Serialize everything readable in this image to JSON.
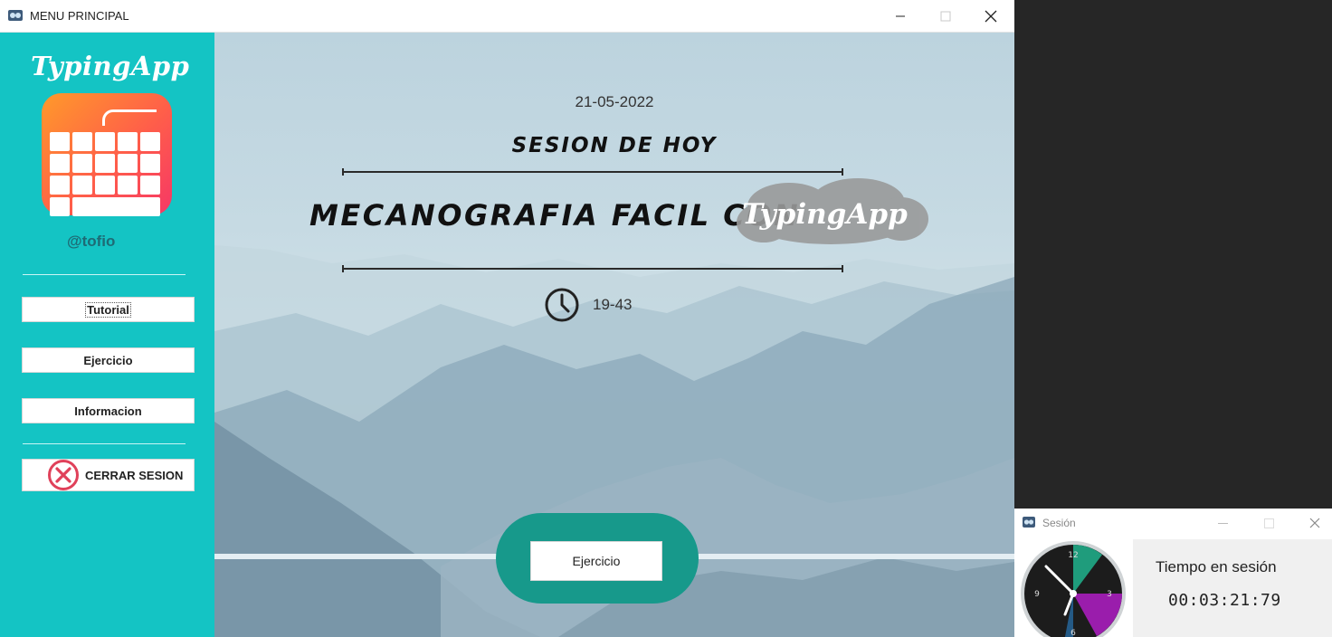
{
  "main_window": {
    "title": "MENU PRINCIPAL",
    "controls": {
      "minimize": "minimize-icon",
      "maximize": "maximize-icon",
      "close": "close-icon"
    }
  },
  "sidebar": {
    "brand": "TypingApp",
    "logo_icon": "keyboard-icon",
    "username": "@tofio",
    "buttons": {
      "tutorial": "Tutorial",
      "ejercicio": "Ejercicio",
      "informacion": "Informacion",
      "logout": "CERRAR SESION"
    },
    "logout_icon": "x-circle-icon",
    "colors": {
      "background": "#14c4c4",
      "logout_icon": "#e0415a"
    }
  },
  "content": {
    "date": "21-05-2022",
    "session_heading": "SESION DE HOY",
    "headline": "MECANOGRAFIA FACIL CON",
    "headline_brand": "TypingApp",
    "time": "19-43",
    "clock_icon": "clock-icon",
    "cta_button": "Ejercicio",
    "colors": {
      "pill": "#17998b"
    }
  },
  "session_window": {
    "title": "Sesión",
    "label": "Tiempo en sesión",
    "elapsed": "00:03:21:79",
    "clock_icon": "analog-clock-icon"
  }
}
